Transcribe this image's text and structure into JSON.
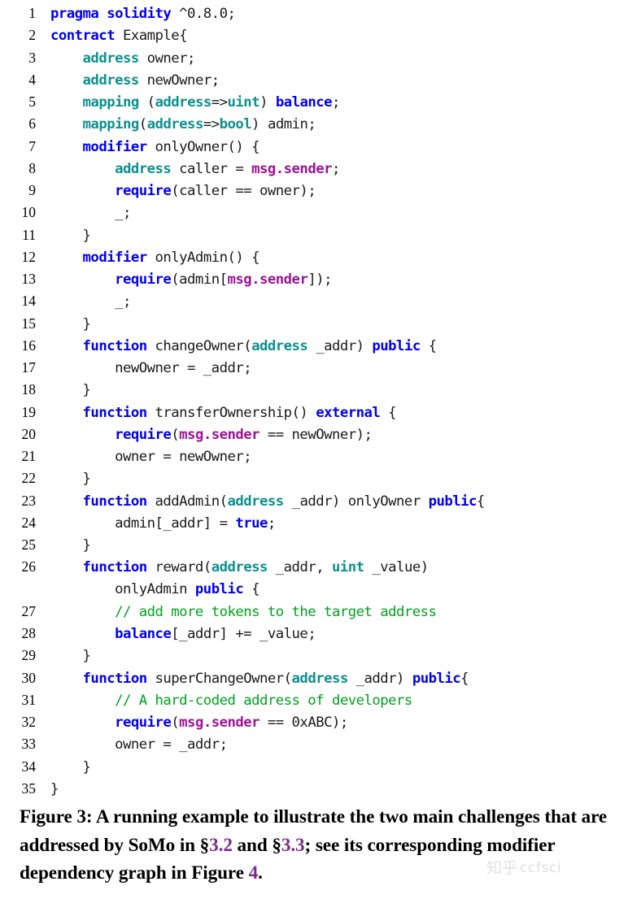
{
  "listing": {
    "language": "solidity",
    "colors": {
      "keyword": "#0000f0",
      "type": "#0e8f8f",
      "global": "#9c1496",
      "comment": "#00a21f",
      "plain": "#1a1a1a"
    },
    "lines": [
      {
        "no": "1",
        "tokens": [
          {
            "t": "kw",
            "s": "pragma solidity"
          },
          {
            "t": "pln",
            "s": " ^0.8.0;"
          }
        ]
      },
      {
        "no": "2",
        "tokens": [
          {
            "t": "kw",
            "s": "contract"
          },
          {
            "t": "pln",
            "s": " Example{"
          }
        ]
      },
      {
        "no": "3",
        "tokens": [
          {
            "t": "pln",
            "s": "    "
          },
          {
            "t": "typ",
            "s": "address"
          },
          {
            "t": "pln",
            "s": " owner;"
          }
        ]
      },
      {
        "no": "4",
        "tokens": [
          {
            "t": "pln",
            "s": "    "
          },
          {
            "t": "typ",
            "s": "address"
          },
          {
            "t": "pln",
            "s": " newOwner;"
          }
        ]
      },
      {
        "no": "5",
        "tokens": [
          {
            "t": "pln",
            "s": "    "
          },
          {
            "t": "typ",
            "s": "mapping"
          },
          {
            "t": "pln",
            "s": " ("
          },
          {
            "t": "typ",
            "s": "address"
          },
          {
            "t": "pln",
            "s": "=>"
          },
          {
            "t": "typ",
            "s": "uint"
          },
          {
            "t": "pln",
            "s": ") "
          },
          {
            "t": "kw",
            "s": "balance"
          },
          {
            "t": "pln",
            "s": ";"
          }
        ]
      },
      {
        "no": "6",
        "tokens": [
          {
            "t": "pln",
            "s": "    "
          },
          {
            "t": "typ",
            "s": "mapping"
          },
          {
            "t": "pln",
            "s": "("
          },
          {
            "t": "typ",
            "s": "address"
          },
          {
            "t": "pln",
            "s": "=>"
          },
          {
            "t": "typ",
            "s": "bool"
          },
          {
            "t": "pln",
            "s": ") admin;"
          }
        ]
      },
      {
        "no": "7",
        "tokens": [
          {
            "t": "pln",
            "s": "    "
          },
          {
            "t": "kw",
            "s": "modifier"
          },
          {
            "t": "pln",
            "s": " onlyOwner() {"
          }
        ]
      },
      {
        "no": "8",
        "tokens": [
          {
            "t": "pln",
            "s": "        "
          },
          {
            "t": "typ",
            "s": "address"
          },
          {
            "t": "pln",
            "s": " caller = "
          },
          {
            "t": "glb",
            "s": "msg.sender"
          },
          {
            "t": "pln",
            "s": ";"
          }
        ]
      },
      {
        "no": "9",
        "tokens": [
          {
            "t": "pln",
            "s": "        "
          },
          {
            "t": "kw",
            "s": "require"
          },
          {
            "t": "pln",
            "s": "(caller == owner);"
          }
        ]
      },
      {
        "no": "10",
        "tokens": [
          {
            "t": "pln",
            "s": "        _;"
          }
        ]
      },
      {
        "no": "11",
        "tokens": [
          {
            "t": "pln",
            "s": "    }"
          }
        ]
      },
      {
        "no": "12",
        "tokens": [
          {
            "t": "pln",
            "s": "    "
          },
          {
            "t": "kw",
            "s": "modifier"
          },
          {
            "t": "pln",
            "s": " onlyAdmin() {"
          }
        ]
      },
      {
        "no": "13",
        "tokens": [
          {
            "t": "pln",
            "s": "        "
          },
          {
            "t": "kw",
            "s": "require"
          },
          {
            "t": "pln",
            "s": "(admin["
          },
          {
            "t": "glb",
            "s": "msg.sender"
          },
          {
            "t": "pln",
            "s": "]);"
          }
        ]
      },
      {
        "no": "14",
        "tokens": [
          {
            "t": "pln",
            "s": "        _;"
          }
        ]
      },
      {
        "no": "15",
        "tokens": [
          {
            "t": "pln",
            "s": "    }"
          }
        ]
      },
      {
        "no": "16",
        "tokens": [
          {
            "t": "pln",
            "s": "    "
          },
          {
            "t": "kw",
            "s": "function"
          },
          {
            "t": "pln",
            "s": " changeOwner("
          },
          {
            "t": "typ",
            "s": "address"
          },
          {
            "t": "pln",
            "s": " _addr) "
          },
          {
            "t": "kw",
            "s": "public"
          },
          {
            "t": "pln",
            "s": " {"
          }
        ]
      },
      {
        "no": "17",
        "tokens": [
          {
            "t": "pln",
            "s": "        newOwner = _addr;"
          }
        ]
      },
      {
        "no": "18",
        "tokens": [
          {
            "t": "pln",
            "s": "    }"
          }
        ]
      },
      {
        "no": "19",
        "tokens": [
          {
            "t": "pln",
            "s": "    "
          },
          {
            "t": "kw",
            "s": "function"
          },
          {
            "t": "pln",
            "s": " transferOwnership() "
          },
          {
            "t": "kw",
            "s": "external"
          },
          {
            "t": "pln",
            "s": " {"
          }
        ]
      },
      {
        "no": "20",
        "tokens": [
          {
            "t": "pln",
            "s": "        "
          },
          {
            "t": "kw",
            "s": "require"
          },
          {
            "t": "pln",
            "s": "("
          },
          {
            "t": "glb",
            "s": "msg.sender"
          },
          {
            "t": "pln",
            "s": " == newOwner);"
          }
        ]
      },
      {
        "no": "21",
        "tokens": [
          {
            "t": "pln",
            "s": "        owner = newOwner;"
          }
        ]
      },
      {
        "no": "22",
        "tokens": [
          {
            "t": "pln",
            "s": "    }"
          }
        ]
      },
      {
        "no": "23",
        "tokens": [
          {
            "t": "pln",
            "s": "    "
          },
          {
            "t": "kw",
            "s": "function"
          },
          {
            "t": "pln",
            "s": " addAdmin("
          },
          {
            "t": "typ",
            "s": "address"
          },
          {
            "t": "pln",
            "s": " _addr) onlyOwner "
          },
          {
            "t": "kw",
            "s": "public"
          },
          {
            "t": "pln",
            "s": "{"
          }
        ]
      },
      {
        "no": "24",
        "tokens": [
          {
            "t": "pln",
            "s": "        admin[_addr] = "
          },
          {
            "t": "kw",
            "s": "true"
          },
          {
            "t": "pln",
            "s": ";"
          }
        ]
      },
      {
        "no": "25",
        "tokens": [
          {
            "t": "pln",
            "s": "    }"
          }
        ]
      },
      {
        "no": "26",
        "tokens": [
          {
            "t": "pln",
            "s": "    "
          },
          {
            "t": "kw",
            "s": "function"
          },
          {
            "t": "pln",
            "s": " reward("
          },
          {
            "t": "typ",
            "s": "address"
          },
          {
            "t": "pln",
            "s": " _addr, "
          },
          {
            "t": "typ",
            "s": "uint"
          },
          {
            "t": "pln",
            "s": " _value)"
          }
        ]
      },
      {
        "no": "",
        "tokens": [
          {
            "t": "pln",
            "s": "        onlyAdmin "
          },
          {
            "t": "kw",
            "s": "public"
          },
          {
            "t": "pln",
            "s": " {"
          }
        ]
      },
      {
        "no": "27",
        "tokens": [
          {
            "t": "pln",
            "s": "        "
          },
          {
            "t": "cmt",
            "s": "// add more tokens to the target address"
          }
        ]
      },
      {
        "no": "28",
        "tokens": [
          {
            "t": "pln",
            "s": "        "
          },
          {
            "t": "kw",
            "s": "balance"
          },
          {
            "t": "pln",
            "s": "[_addr] += _value;"
          }
        ]
      },
      {
        "no": "29",
        "tokens": [
          {
            "t": "pln",
            "s": "    }"
          }
        ]
      },
      {
        "no": "30",
        "tokens": [
          {
            "t": "pln",
            "s": "    "
          },
          {
            "t": "kw",
            "s": "function"
          },
          {
            "t": "pln",
            "s": " superChangeOwner("
          },
          {
            "t": "typ",
            "s": "address"
          },
          {
            "t": "pln",
            "s": " _addr) "
          },
          {
            "t": "kw",
            "s": "public"
          },
          {
            "t": "pln",
            "s": "{"
          }
        ]
      },
      {
        "no": "31",
        "tokens": [
          {
            "t": "pln",
            "s": "        "
          },
          {
            "t": "cmt",
            "s": "// A hard-coded address of developers"
          }
        ]
      },
      {
        "no": "32",
        "tokens": [
          {
            "t": "pln",
            "s": "        "
          },
          {
            "t": "kw",
            "s": "require"
          },
          {
            "t": "pln",
            "s": "("
          },
          {
            "t": "glb",
            "s": "msg.sender"
          },
          {
            "t": "pln",
            "s": " == 0xABC);"
          }
        ]
      },
      {
        "no": "33",
        "tokens": [
          {
            "t": "pln",
            "s": "        owner = _addr;"
          }
        ]
      },
      {
        "no": "34",
        "tokens": [
          {
            "t": "pln",
            "s": "    }"
          }
        ]
      },
      {
        "no": "35",
        "tokens": [
          {
            "t": "pln",
            "s": "}"
          }
        ]
      }
    ]
  },
  "caption": {
    "parts": [
      {
        "t": "plain",
        "s": "Figure 3: A running example to illustrate the two main challenges that are addressed by SoMo in §"
      },
      {
        "t": "xref",
        "s": "3.2"
      },
      {
        "t": "plain",
        "s": " and §"
      },
      {
        "t": "xref",
        "s": "3.3"
      },
      {
        "t": "plain",
        "s": "; see its corresponding modifier dependency graph in Figure "
      },
      {
        "t": "xref",
        "s": "4"
      },
      {
        "t": "plain",
        "s": "."
      }
    ],
    "xref_color": "#7d2b8b"
  },
  "watermark": {
    "logo": "知乎",
    "text": "ccfsci"
  }
}
